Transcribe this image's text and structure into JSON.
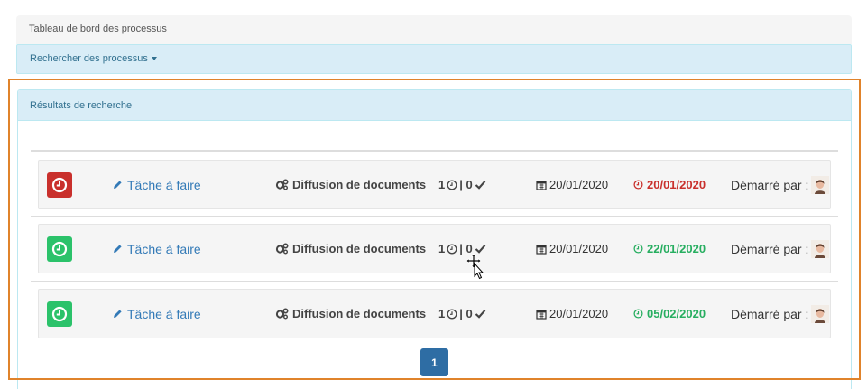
{
  "breadcrumb": {
    "title": "Tableau de bord des processus"
  },
  "search": {
    "label": "Rechercher des processus"
  },
  "results": {
    "header": "Résultats de recherche",
    "rows": [
      {
        "status": "red",
        "task_label": "Tâche à faire",
        "process_name": "Diffusion de documents",
        "count_pending": "1",
        "separator": "|",
        "count_done": "0",
        "start_date": "20/01/2020",
        "due_date": "20/01/2020",
        "due_status": "red",
        "started_by_label": "Démarré par :"
      },
      {
        "status": "green",
        "task_label": "Tâche à faire",
        "process_name": "Diffusion de documents",
        "count_pending": "1",
        "separator": "|",
        "count_done": "0",
        "start_date": "20/01/2020",
        "due_date": "22/01/2020",
        "due_status": "green",
        "started_by_label": "Démarré par :"
      },
      {
        "status": "green",
        "task_label": "Tâche à faire",
        "process_name": "Diffusion de documents",
        "count_pending": "1",
        "separator": "|",
        "count_done": "0",
        "start_date": "20/01/2020",
        "due_date": "05/02/2020",
        "due_status": "green",
        "started_by_label": "Démarré par :"
      }
    ]
  },
  "pagination": {
    "current_page": "1"
  },
  "icons": {
    "status": "clock-icon",
    "task": "pencil-icon",
    "process": "gears-icon",
    "pending": "clock-icon",
    "done": "check-icon",
    "start_date": "calendar-icon",
    "due_date": "clock-icon",
    "avatar": "user-avatar"
  },
  "colors": {
    "overdue": "#c9302c",
    "on_time": "#2bc26a",
    "link": "#337ab7",
    "panel_header": "#d9edf7",
    "highlight": "#e0832b",
    "page_button": "#2e6da4"
  }
}
